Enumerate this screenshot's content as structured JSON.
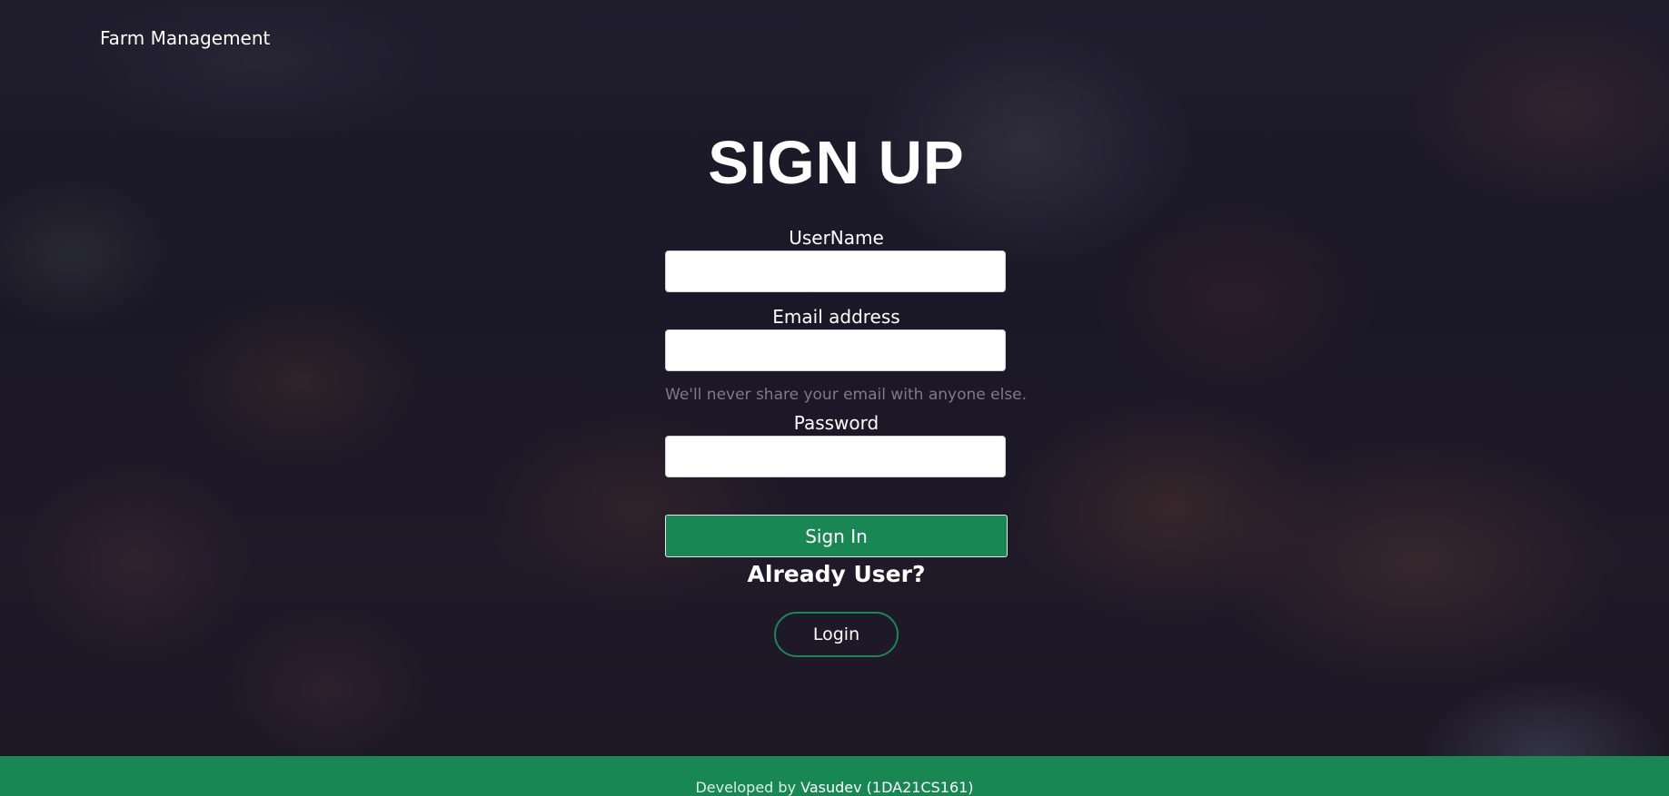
{
  "navbar": {
    "brand": "Farm Management"
  },
  "form": {
    "title": "SIGN UP",
    "username_label": "UserName",
    "username_value": "",
    "email_label": "Email address",
    "email_value": "",
    "email_help": "We'll never share your email with anyone else.",
    "password_label": "Password",
    "password_value": "",
    "submit_label": "Sign In",
    "already_user_text": "Already User?",
    "login_label": "Login"
  },
  "footer": {
    "prefix": "Developed by",
    "developer": "Vasudev (1DA21CS161)"
  },
  "colors": {
    "accent": "#198754",
    "overlay": "#1d1b2b",
    "text": "#ffffff"
  }
}
